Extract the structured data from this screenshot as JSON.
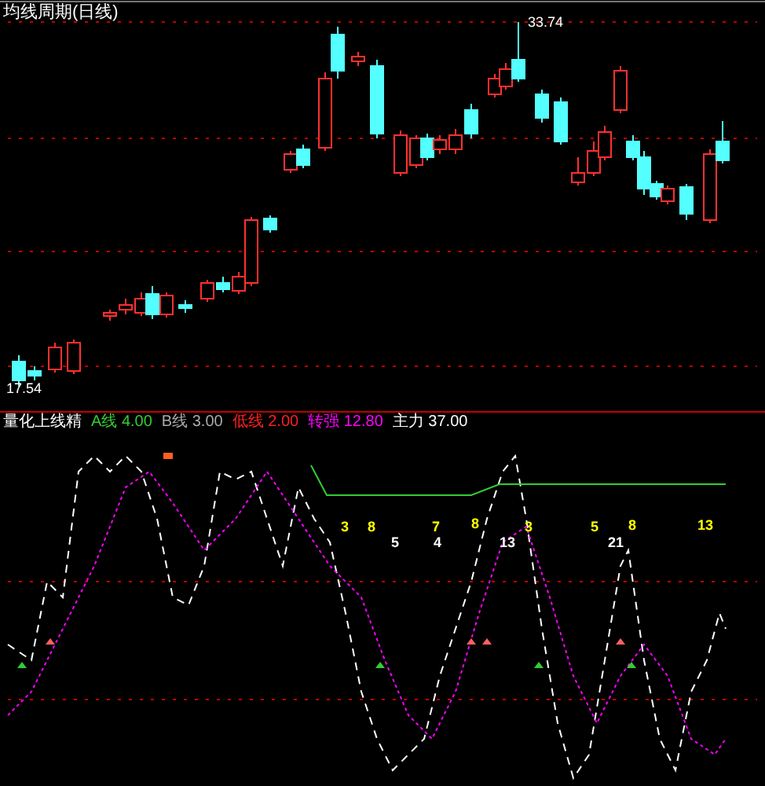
{
  "price_panel": {
    "title": "均线周期(日线)",
    "high_label": "33.74",
    "low_label": "17.54"
  },
  "indicator_panel": {
    "legend": [
      {
        "text": "量化上线精",
        "color": "#ffffff"
      },
      {
        "text": "A线 4.00",
        "color": "#33cc33"
      },
      {
        "text": "B线 3.00",
        "color": "#aaaaaa"
      },
      {
        "text": "低线 2.00",
        "color": "#ff2020"
      },
      {
        "text": "转强 12.80",
        "color": "#ff00ff"
      },
      {
        "text": "主力 37.00",
        "color": "#ffffff"
      }
    ],
    "markers": [
      {
        "text": "3",
        "color": "#ffff00"
      },
      {
        "text": "8",
        "color": "#ffff00"
      },
      {
        "text": "7",
        "color": "#ffff00"
      },
      {
        "text": "8",
        "color": "#ffff00"
      },
      {
        "text": "3",
        "color": "#ffff00"
      },
      {
        "text": "5",
        "color": "#ffff00"
      },
      {
        "text": "8",
        "color": "#ffff00"
      },
      {
        "text": "13",
        "color": "#ffff00"
      },
      {
        "text": "5",
        "color": "#ffffff"
      },
      {
        "text": "4",
        "color": "#ffffff"
      },
      {
        "text": "13",
        "color": "#ffffff"
      },
      {
        "text": "21",
        "color": "#ffffff"
      }
    ]
  }
}
